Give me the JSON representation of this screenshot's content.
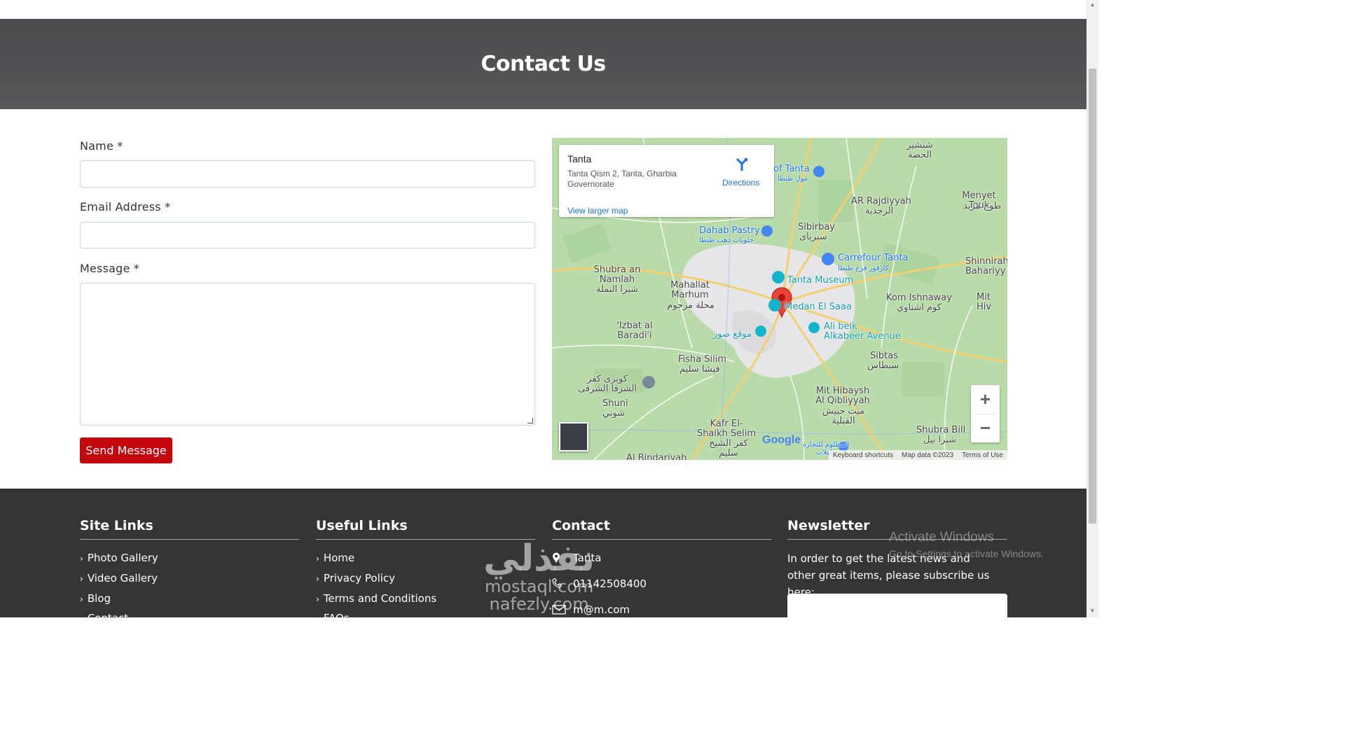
{
  "hero": {
    "title": "Contact Us"
  },
  "form": {
    "name_label": "Name *",
    "email_label": "Email Address *",
    "message_label": "Message *",
    "send_label": "Send Message"
  },
  "map": {
    "card_title": "Tanta",
    "card_address": "Tanta Qism 2, Tanta, Gharbia Governorate",
    "directions_label": "Directions",
    "larger_map_label": "View larger map",
    "footer": {
      "shortcuts": "Keyboard shortcuts",
      "data": "Map data ©2023",
      "terms": "Terms of Use"
    },
    "google_label": "Google",
    "places": [
      {
        "name": "Tanta Museum",
        "style": "teal"
      },
      {
        "name": "Medan El Saaa",
        "style": "teal"
      },
      {
        "name": "Carrefour Tanta",
        "style": "blue"
      },
      {
        "name": "كارفور فرع طنطا",
        "style": "blue"
      },
      {
        "name": "Dahab Pastry",
        "style": "blue"
      },
      {
        "name": "حلويات دهب طنطا",
        "style": "blue"
      },
      {
        "name": "Ali beik",
        "style": "teal"
      },
      {
        "name": "Alkabeer Avenue",
        "style": "teal"
      },
      {
        "name": "موقع صور",
        "style": "teal"
      },
      {
        "name": "of Tanta",
        "style": "blue"
      },
      {
        "name": "مول طنطا",
        "style": "blue"
      },
      {
        "name": "Sibirbay",
        "style": "plain"
      },
      {
        "name": "سبرباى",
        "style": "plain"
      },
      {
        "name": "AR Rajdiyyah",
        "style": "plain"
      },
      {
        "name": "الرجدية",
        "style": "plain"
      },
      {
        "name": "Menyet Touk",
        "style": "plain"
      },
      {
        "name": "طوخ مزيد",
        "style": "plain"
      },
      {
        "name": "Shubra an Namlah",
        "style": "plain"
      },
      {
        "name": "شبرا النملة",
        "style": "plain"
      },
      {
        "name": "Mahallat Marhum",
        "style": "plain"
      },
      {
        "name": "محلة مرحوم",
        "style": "plain"
      },
      {
        "name": "'Izbat al Baradi'i",
        "style": "plain"
      },
      {
        "name": "Fisha Silim",
        "style": "plain"
      },
      {
        "name": "فيشا سليم",
        "style": "plain"
      },
      {
        "name": "كوبرى كفر الشرفا الشرقى",
        "style": "plain"
      },
      {
        "name": "Shuni",
        "style": "plain"
      },
      {
        "name": "شوني",
        "style": "plain"
      },
      {
        "name": "Kafr El-Shaikh Selim",
        "style": "plain"
      },
      {
        "name": "كفر الشيخ سليم",
        "style": "plain"
      },
      {
        "name": "Mit Hibaysh Al Qibliyyah",
        "style": "plain"
      },
      {
        "name": "ميت حبيش القبلية",
        "style": "plain"
      },
      {
        "name": "Kom Ishnaway",
        "style": "plain"
      },
      {
        "name": "كوم اشناوي",
        "style": "plain"
      },
      {
        "name": "Sibtas",
        "style": "plain"
      },
      {
        "name": "سبطاس",
        "style": "plain"
      },
      {
        "name": "Shubra Bill",
        "style": "plain"
      },
      {
        "name": "شبرا بيل",
        "style": "plain"
      },
      {
        "name": "Shinnirah Bahariyy",
        "style": "plain"
      },
      {
        "name": "Mit Hiv",
        "style": "plain"
      },
      {
        "name": "المظلوم للتجارة وكيلات",
        "style": "blue"
      },
      {
        "name": "شبشير الحصة",
        "style": "plain"
      },
      {
        "name": "Al Bindariyah",
        "style": "plain"
      }
    ]
  },
  "footer": {
    "site_links": {
      "title": "Site Links",
      "items": [
        "Photo Gallery",
        "Video Gallery",
        "Blog",
        "Contact"
      ]
    },
    "useful_links": {
      "title": "Useful Links",
      "items": [
        "Home",
        "Privacy Policy",
        "Terms and Conditions",
        "FAQs"
      ]
    },
    "contact": {
      "title": "Contact",
      "city": "Tanta",
      "phone": "01142508400",
      "email": "m@m.com"
    },
    "newsletter": {
      "title": "Newsletter",
      "text": "In order to get the latest news and other great items, please subscribe us here:"
    }
  },
  "watermark": {
    "arabic": "نفذلي",
    "latin": "mostaql.com",
    "latin2": "nafezly.com"
  },
  "os_overlay": {
    "title": "Activate Windows",
    "subtitle": "Go to Settings to activate Windows."
  }
}
